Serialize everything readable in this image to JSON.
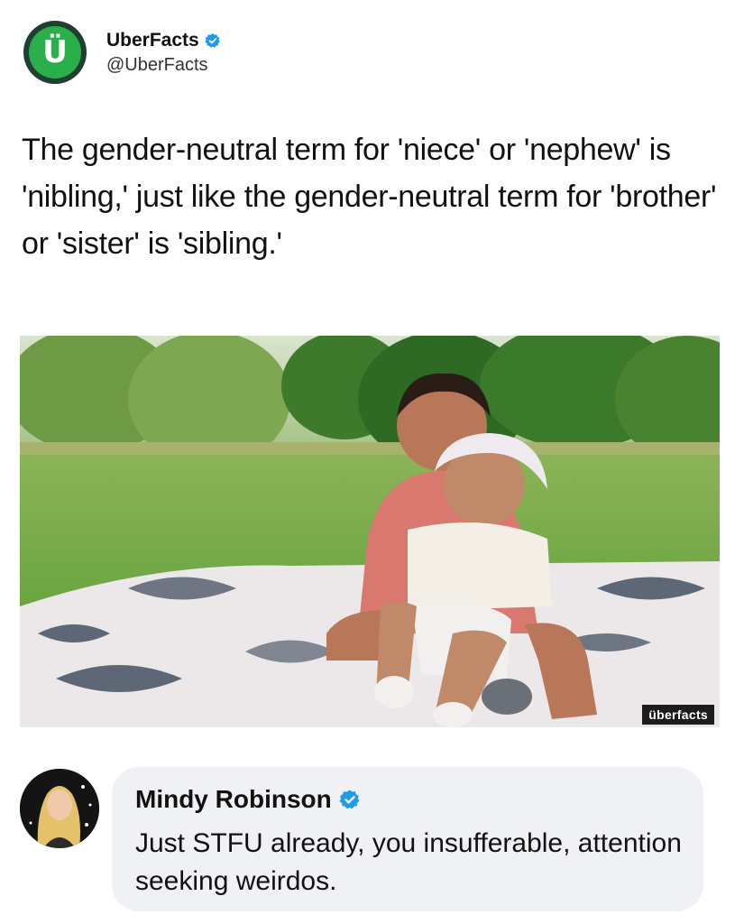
{
  "tweet": {
    "logo_letter": "Ü",
    "display_name": "UberFacts",
    "handle": "@UberFacts",
    "text": "The gender-neutral term for 'niece' or 'nephew' is 'nibling,' just like the gender-neutral term for 'brother' or 'sister' is 'sibling.'",
    "image": {
      "description_icon": "photo-two-children-on-blanket",
      "watermark": "überfacts"
    }
  },
  "reply": {
    "display_name": "Mindy Robinson",
    "text": "Just STFU already, you insufferable, attention seeking weirdos."
  },
  "colors": {
    "verified_blue": "#1d9bf0",
    "logo_green": "#29b04a",
    "logo_dark": "#1f3f31",
    "bubble_bg": "#eff1f4"
  }
}
